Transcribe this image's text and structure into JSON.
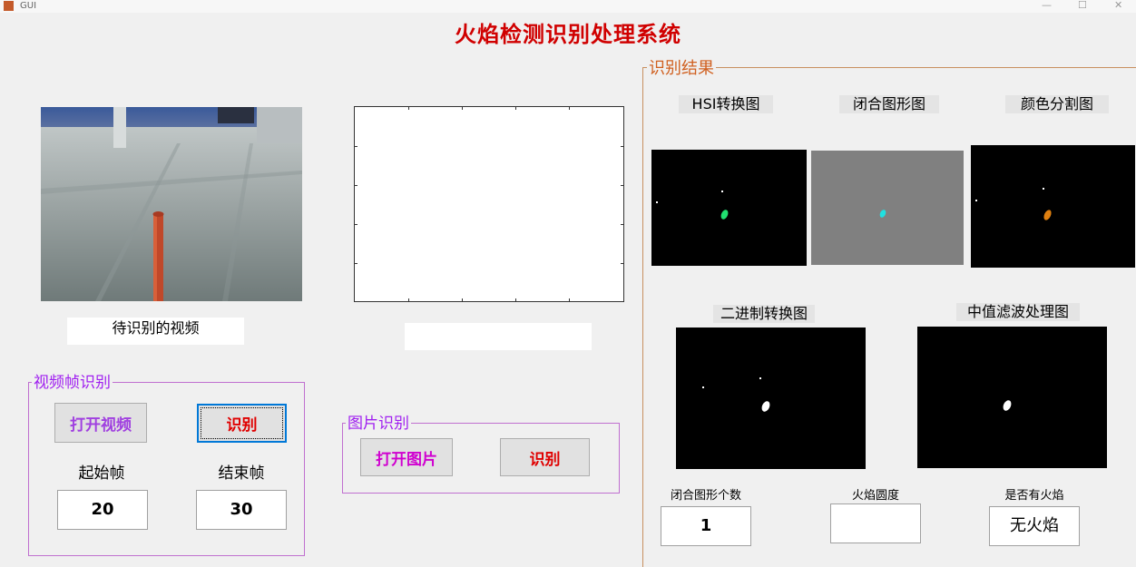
{
  "window": {
    "title": "GUI",
    "minimize": "—",
    "maximize": "☐",
    "close": "✕"
  },
  "app_title": "火焰检测识别处理系统",
  "video": {
    "caption": "待识别的视频",
    "caption2": ""
  },
  "video_panel": {
    "title": "视频帧识别",
    "open_button": "打开视频",
    "recognize_button": "识别",
    "start_label": "起始帧",
    "end_label": "结束帧",
    "start_value": "20",
    "end_value": "30"
  },
  "image_panel": {
    "title": "图片识别",
    "open_button": "打开图片",
    "recognize_button": "识别"
  },
  "results": {
    "title": "识别结果",
    "hsi_label": "HSI转换图",
    "closed_label": "闭合图形图",
    "color_label": "颜色分割图",
    "binary_label": "二进制转换图",
    "median_label": "中值滤波处理图",
    "count_label": "闭合图形个数",
    "roundness_label": "火焰圆度",
    "fire_label": "是否有火焰",
    "count_value": "1",
    "roundness_value": "",
    "fire_value": "无火焰"
  },
  "colors": {
    "title_red": "#d00000",
    "panel_border": "#c070d0",
    "result_border": "#c89060",
    "result_title": "#d06020",
    "purple_text": "#a020f0",
    "magenta_text": "#d000d0",
    "red_text": "#e00000"
  }
}
